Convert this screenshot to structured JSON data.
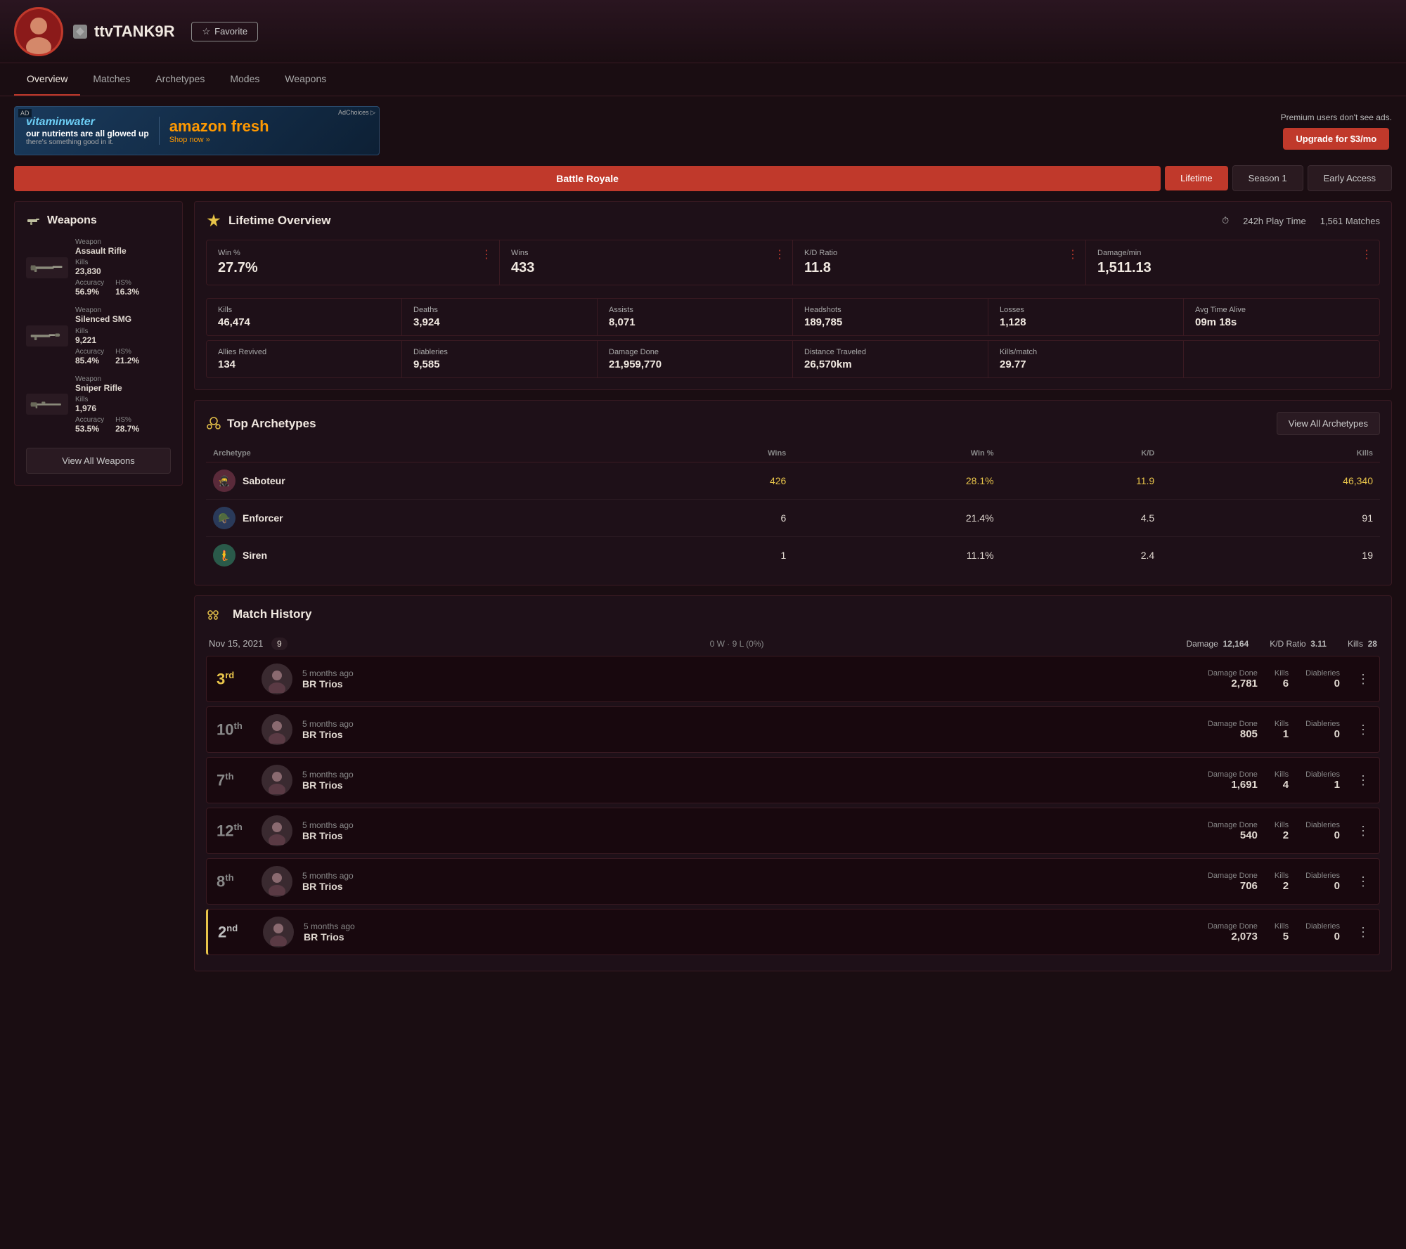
{
  "header": {
    "avatar_emoji": "👤",
    "game_icon": "⚡",
    "username": "ttvTANK9R",
    "favorite_label": "Favorite",
    "star_icon": "☆"
  },
  "nav": {
    "items": [
      {
        "label": "Overview",
        "active": true
      },
      {
        "label": "Matches",
        "active": false
      },
      {
        "label": "Archetypes",
        "active": false
      },
      {
        "label": "Modes",
        "active": false
      },
      {
        "label": "Weapons",
        "active": false
      }
    ]
  },
  "ad": {
    "ad_label": "AD",
    "brand1": "vitaminwater",
    "tagline": "our nutrients are all glowed up",
    "sub_tagline": "there's something good in it.",
    "brand2": "amazon fresh",
    "shop_label": "Shop now »",
    "adchoices": "AdChoices ▷"
  },
  "premium": {
    "message": "Premium users don't see ads.",
    "button_label": "Upgrade for $3/mo"
  },
  "modes": {
    "active": "Battle Royale",
    "seasons": [
      "Lifetime",
      "Season 1",
      "Early Access"
    ]
  },
  "weapons_panel": {
    "title": "Weapons",
    "weapons": [
      {
        "type_label": "Weapon",
        "name": "Assault Rifle",
        "kills_label": "Kills",
        "kills": "23,830",
        "accuracy_label": "Accuracy",
        "accuracy": "56.9%",
        "hs_label": "HS%",
        "hs": "16.3%"
      },
      {
        "type_label": "Weapon",
        "name": "Silenced SMG",
        "kills_label": "Kills",
        "kills": "9,221",
        "accuracy_label": "Accuracy",
        "accuracy": "85.4%",
        "hs_label": "HS%",
        "hs": "21.2%"
      },
      {
        "type_label": "Weapon",
        "name": "Sniper Rifle",
        "kills_label": "Kills",
        "kills": "1,976",
        "accuracy_label": "Accuracy",
        "accuracy": "53.5%",
        "hs_label": "HS%",
        "hs": "28.7%"
      }
    ],
    "view_all_label": "View All Weapons"
  },
  "overview": {
    "title": "Lifetime Overview",
    "clock_icon": "⏱",
    "playtime": "242h Play Time",
    "matches": "1,561 Matches",
    "stats_top": [
      {
        "label": "Win %",
        "value": "27.7%",
        "gold": false
      },
      {
        "label": "Wins",
        "value": "433",
        "gold": false
      },
      {
        "label": "K/D Ratio",
        "value": "11.8",
        "gold": false
      },
      {
        "label": "Damage/min",
        "value": "1,511.13",
        "gold": false
      }
    ],
    "stats_bottom": [
      {
        "label": "Kills",
        "value": "46,474"
      },
      {
        "label": "Deaths",
        "value": "3,924"
      },
      {
        "label": "Assists",
        "value": "8,071"
      },
      {
        "label": "Headshots",
        "value": "189,785"
      },
      {
        "label": "Losses",
        "value": "1,128"
      },
      {
        "label": "Avg Time Alive",
        "value": "09m 18s"
      }
    ],
    "stats_bottom2": [
      {
        "label": "Allies Revived",
        "value": "134"
      },
      {
        "label": "Diableries",
        "value": "9,585"
      },
      {
        "label": "Damage Done",
        "value": "21,959,770"
      },
      {
        "label": "Distance Traveled",
        "value": "26,570km"
      },
      {
        "label": "Kills/match",
        "value": "29.77"
      },
      {
        "label": "",
        "value": ""
      }
    ]
  },
  "archetypes": {
    "title": "Top Archetypes",
    "view_all_label": "View All Archetypes",
    "columns": [
      "Archetype",
      "Wins",
      "Win %",
      "K/D",
      "Kills"
    ],
    "rows": [
      {
        "name": "Saboteur",
        "wins": "426",
        "win_pct": "28.1%",
        "kd": "11.9",
        "kills": "46,340",
        "gold": true
      },
      {
        "name": "Enforcer",
        "wins": "6",
        "win_pct": "21.4%",
        "kd": "4.5",
        "kills": "91",
        "gold": false
      },
      {
        "name": "Siren",
        "wins": "1",
        "win_pct": "11.1%",
        "kd": "2.4",
        "kills": "19",
        "gold": false
      }
    ]
  },
  "match_history": {
    "title": "Match History",
    "day": {
      "date": "Nov 15, 2021",
      "count": "9",
      "record": "0 W · 9 L (0%)",
      "damage_label": "Damage",
      "damage": "12,164",
      "kd_label": "K/D Ratio",
      "kd": "3.11",
      "kills_label": "Kills",
      "kills": "28"
    },
    "matches": [
      {
        "place": "3",
        "suffix": "rd",
        "highlight": false,
        "time": "5 months ago",
        "mode": "BR Trios",
        "damage_label": "Damage Done",
        "damage": "2,781",
        "kills_label": "Kills",
        "kills": "6",
        "diab_label": "Diableries",
        "diableries": "0"
      },
      {
        "place": "10",
        "suffix": "th",
        "highlight": false,
        "time": "5 months ago",
        "mode": "BR Trios",
        "damage_label": "Damage Done",
        "damage": "805",
        "kills_label": "Kills",
        "kills": "1",
        "diab_label": "Diableries",
        "diableries": "0"
      },
      {
        "place": "7",
        "suffix": "th",
        "highlight": false,
        "time": "5 months ago",
        "mode": "BR Trios",
        "damage_label": "Damage Done",
        "damage": "1,691",
        "kills_label": "Kills",
        "kills": "4",
        "diab_label": "Diableries",
        "diableries": "1"
      },
      {
        "place": "12",
        "suffix": "th",
        "highlight": false,
        "time": "5 months ago",
        "mode": "BR Trios",
        "damage_label": "Damage Done",
        "damage": "540",
        "kills_label": "Kills",
        "kills": "2",
        "diab_label": "Diableries",
        "diableries": "0"
      },
      {
        "place": "8",
        "suffix": "th",
        "highlight": false,
        "time": "5 months ago",
        "mode": "BR Trios",
        "damage_label": "Damage Done",
        "damage": "706",
        "kills_label": "Kills",
        "kills": "2",
        "diab_label": "Diableries",
        "diableries": "0"
      },
      {
        "place": "2",
        "suffix": "nd",
        "highlight": true,
        "time": "5 months ago",
        "mode": "BR Trios",
        "damage_label": "Damage Done",
        "damage": "2,073",
        "kills_label": "Kills",
        "kills": "5",
        "diab_label": "Diableries",
        "diableries": "0"
      }
    ]
  }
}
